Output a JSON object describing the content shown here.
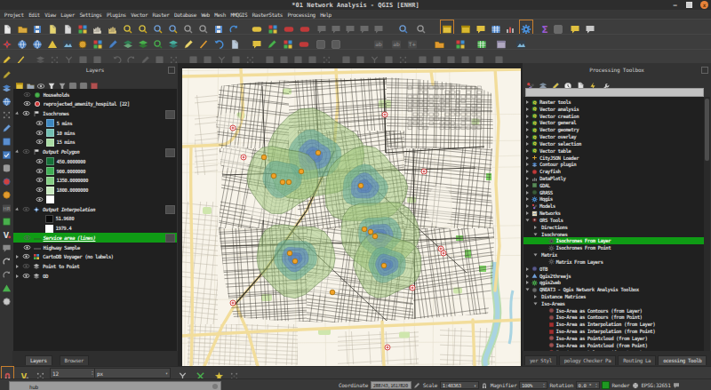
{
  "window": {
    "title": "*01 Network Analysis - QGIS [ENHR]",
    "controls": {
      "minimize": "–",
      "maximize": "",
      "close": "x"
    }
  },
  "menubar": [
    "Project",
    "Edit",
    "View",
    "Layer",
    "Settings",
    "Plugins",
    "Vector",
    "Raster",
    "Database",
    "Web",
    "Mesh",
    "MMQGIS",
    "RasterStats",
    "Processing",
    "Help"
  ],
  "layers_panel": {
    "title": "Layers",
    "tabs": [
      {
        "label": "Layers",
        "active": true
      },
      {
        "label": "Browser",
        "active": false
      }
    ],
    "tree": [
      {
        "indent": 1,
        "arrow": "none",
        "vis": "dim",
        "icon": "point-green",
        "label": "Households"
      },
      {
        "indent": 1,
        "arrow": "none",
        "vis": "eye",
        "icon": "hospital",
        "label": "reprojected_amenity_hospital [22]"
      },
      {
        "indent": 0,
        "arrow": "open",
        "vis": "eye",
        "icon": "group",
        "label": "Isochrones",
        "bold": true,
        "badge": true
      },
      {
        "indent": 2,
        "arrow": "none",
        "vis": "eye",
        "swatch": "#3d87c0",
        "label": "5 mins"
      },
      {
        "indent": 2,
        "arrow": "none",
        "vis": "eye",
        "swatch": "#72bfb2",
        "label": "10 mins"
      },
      {
        "indent": 2,
        "arrow": "none",
        "vis": "eye",
        "swatch": "#a9dca4",
        "label": "15 mins"
      },
      {
        "indent": 0,
        "arrow": "open",
        "vis": "dim",
        "icon": "group",
        "label": "Output Polygon",
        "italic": true,
        "badge": true
      },
      {
        "indent": 2,
        "arrow": "none",
        "vis": "eye",
        "swatch": "#156f37",
        "label": "450.0000000"
      },
      {
        "indent": 2,
        "arrow": "none",
        "vis": "eye",
        "swatch": "#3fae54",
        "label": "900.0000000"
      },
      {
        "indent": 2,
        "arrow": "none",
        "vis": "eye",
        "swatch": "#84cf84",
        "label": "1350.0000000"
      },
      {
        "indent": 2,
        "arrow": "none",
        "vis": "eye",
        "swatch": "#c8eabf",
        "label": "1800.0000000"
      },
      {
        "indent": 2,
        "arrow": "none",
        "vis": "eye",
        "swatch": "#ffffff",
        "label": ""
      },
      {
        "indent": 0,
        "arrow": "open",
        "vis": "dim",
        "icon": "interp",
        "label": "Output Interpolation",
        "italic": true,
        "badge": true
      },
      {
        "indent": 2,
        "arrow": "none",
        "vis": "none",
        "swatch": "#0a0a0a",
        "label": "51.9680"
      },
      {
        "indent": 2,
        "arrow": "none",
        "vis": "none",
        "swatch": "#ffffff",
        "label": "1979.4"
      },
      {
        "indent": 1,
        "arrow": "none",
        "vis": "dim",
        "icon": "line-green",
        "label": "Service area (lines)",
        "italic": true,
        "underline": true,
        "selected": true,
        "badge": true
      },
      {
        "indent": 1,
        "arrow": "none",
        "vis": "eye",
        "icon": "line-dark",
        "label": "Highway Sample"
      },
      {
        "indent": 0,
        "arrow": "closed",
        "vis": "eye",
        "icon": "xyz",
        "label": "CartoDB Voyager (no labels)",
        "bold": true
      },
      {
        "indent": 0,
        "arrow": "closed",
        "vis": "dim",
        "icon": "group2",
        "label": "Point to Point"
      },
      {
        "indent": 0,
        "arrow": "closed",
        "vis": "eye",
        "icon": "group2",
        "label": "OD"
      }
    ]
  },
  "processing_panel": {
    "title": "Processing Toolbox",
    "search_value": "",
    "tabs": [
      {
        "label": "yer Styl",
        "active": false
      },
      {
        "label": "pology Checker Pa",
        "active": false
      },
      {
        "label": "Routing La",
        "active": false
      },
      {
        "label": "ocessing Toolb",
        "active": true
      }
    ],
    "tree": [
      {
        "indent": 0,
        "arrow": "closed",
        "icon": "q",
        "label": "Raster tools"
      },
      {
        "indent": 0,
        "arrow": "closed",
        "icon": "q",
        "label": "Vector analysis"
      },
      {
        "indent": 0,
        "arrow": "closed",
        "icon": "q",
        "label": "Vector creation"
      },
      {
        "indent": 0,
        "arrow": "closed",
        "icon": "q",
        "label": "Vector general"
      },
      {
        "indent": 0,
        "arrow": "closed",
        "icon": "q",
        "label": "Vector geometry"
      },
      {
        "indent": 0,
        "arrow": "closed",
        "icon": "q",
        "label": "Vector overlay"
      },
      {
        "indent": 0,
        "arrow": "closed",
        "icon": "q",
        "label": "Vector selection"
      },
      {
        "indent": 0,
        "arrow": "closed",
        "icon": "q",
        "label": "Vector table"
      },
      {
        "indent": 0,
        "arrow": "closed",
        "icon": "cityjson",
        "label": "CityJSON Loader"
      },
      {
        "indent": 0,
        "arrow": "closed",
        "icon": "contour",
        "label": "Contour plugin"
      },
      {
        "indent": 0,
        "arrow": "closed",
        "icon": "crayfish",
        "label": "Crayfish"
      },
      {
        "indent": 0,
        "arrow": "closed",
        "icon": "dataplotly",
        "label": "DataPlotly"
      },
      {
        "indent": 0,
        "arrow": "closed",
        "icon": "gdal",
        "label": "GDAL"
      },
      {
        "indent": 0,
        "arrow": "closed",
        "icon": "grass",
        "label": "GRASS"
      },
      {
        "indent": 0,
        "arrow": "closed",
        "icon": "hqgis",
        "label": "Hqgis"
      },
      {
        "indent": 0,
        "arrow": "closed",
        "icon": "models",
        "label": "Models"
      },
      {
        "indent": 0,
        "arrow": "closed",
        "icon": "networks",
        "label": "Networks"
      },
      {
        "indent": 0,
        "arrow": "open",
        "icon": "ors",
        "label": "ORS Tools"
      },
      {
        "indent": 1,
        "arrow": "closed",
        "icon": null,
        "label": "Directions"
      },
      {
        "indent": 1,
        "arrow": "open",
        "icon": null,
        "label": "Isochrones"
      },
      {
        "indent": 2,
        "arrow": "none",
        "icon": "alg",
        "label": "Isochrones From Layer",
        "selected": true
      },
      {
        "indent": 2,
        "arrow": "none",
        "icon": "alg",
        "label": "Isochrones From Point"
      },
      {
        "indent": 1,
        "arrow": "open",
        "icon": null,
        "label": "Matrix"
      },
      {
        "indent": 2,
        "arrow": "none",
        "icon": "alg",
        "label": "Matrix From Layers"
      },
      {
        "indent": 0,
        "arrow": "closed",
        "icon": "otb",
        "label": "OTB"
      },
      {
        "indent": 0,
        "arrow": "closed",
        "icon": "q2t",
        "label": "Qgis2threejs"
      },
      {
        "indent": 0,
        "arrow": "closed",
        "icon": "q2w",
        "label": "qgis2web"
      },
      {
        "indent": 0,
        "arrow": "open",
        "icon": "qneat",
        "label": "QNEAT3 - Qgis Network Analysis Toolbox"
      },
      {
        "indent": 1,
        "arrow": "closed",
        "icon": null,
        "label": "Distance Matrices"
      },
      {
        "indent": 1,
        "arrow": "open",
        "icon": null,
        "label": "Iso-Areas"
      },
      {
        "indent": 2,
        "arrow": "none",
        "icon": "isoc",
        "label": "Iso-Area as Contours (from Layer)"
      },
      {
        "indent": 2,
        "arrow": "none",
        "icon": "isoc",
        "label": "Iso-Area as Contours (from Point)"
      },
      {
        "indent": 2,
        "arrow": "none",
        "icon": "isoi",
        "label": "Iso-Area as Interpolation (from Layer)"
      },
      {
        "indent": 2,
        "arrow": "none",
        "icon": "isoi",
        "label": "Iso-Area as Interpolation (from Point)"
      },
      {
        "indent": 2,
        "arrow": "none",
        "icon": "isop",
        "label": "Iso-Area as Pointcloud (from Layer)"
      },
      {
        "indent": 2,
        "arrow": "none",
        "icon": "isop",
        "label": "Iso-Area as Pointcloud (from Point)"
      },
      {
        "indent": 2,
        "arrow": "none",
        "icon": "isog",
        "label": "Iso-Area as Polygons (from Layer)"
      }
    ]
  },
  "snapbar": {
    "tolerance_value": "12",
    "units_value": "px"
  },
  "statusbar": {
    "locator_value": "hub",
    "coordinate_label": "Coordinate",
    "coordinate_value": "288743,1617820",
    "scale_label": "Scale",
    "scale_value": "1:48363",
    "magnifier_label": "Magnifier",
    "magnifier_value": "100%",
    "rotation_label": "Rotation",
    "rotation_value": "0.0 °",
    "render_label": "Render",
    "crs_value": "EPSG:32651"
  },
  "map": {
    "description": "street map of city with hospital isochrone overlay",
    "isochrone_colors": {
      "5min": "#5b8fc9",
      "10min": "#6fb3a4",
      "15min": "#a3cc87"
    },
    "hospital_color": "#f2a227",
    "selection_color": "#0f9b15"
  }
}
